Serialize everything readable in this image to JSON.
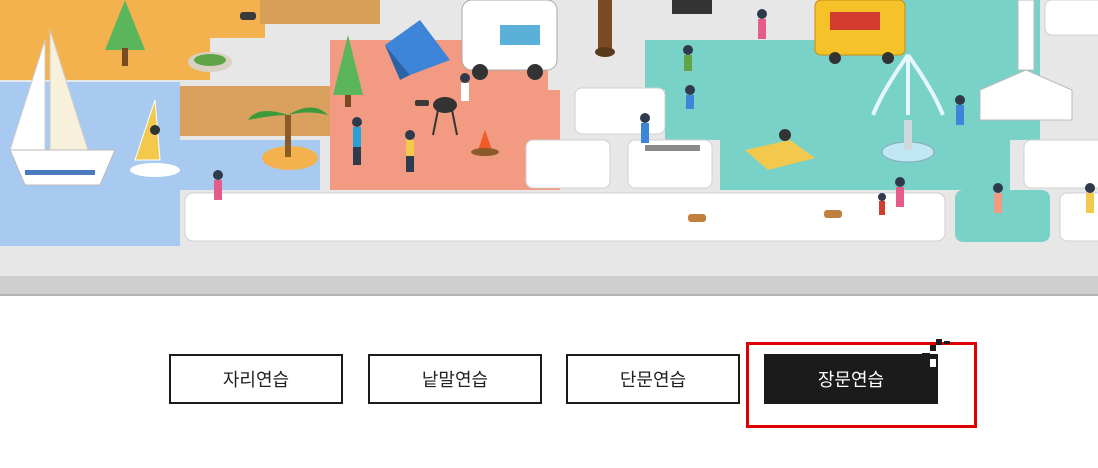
{
  "tabs": [
    {
      "label": "자리연습",
      "active": false
    },
    {
      "label": "낱말연습",
      "active": false
    },
    {
      "label": "단문연습",
      "active": false
    },
    {
      "label": "장문연습",
      "active": true
    }
  ],
  "colors": {
    "active_tab_bg": "#1b1b1b",
    "highlight": "#e00000",
    "sea_key": "#a9caf0",
    "park_key": "#79d2c8",
    "camp_key": "#f39a82",
    "field_key": "#f4b24e"
  }
}
